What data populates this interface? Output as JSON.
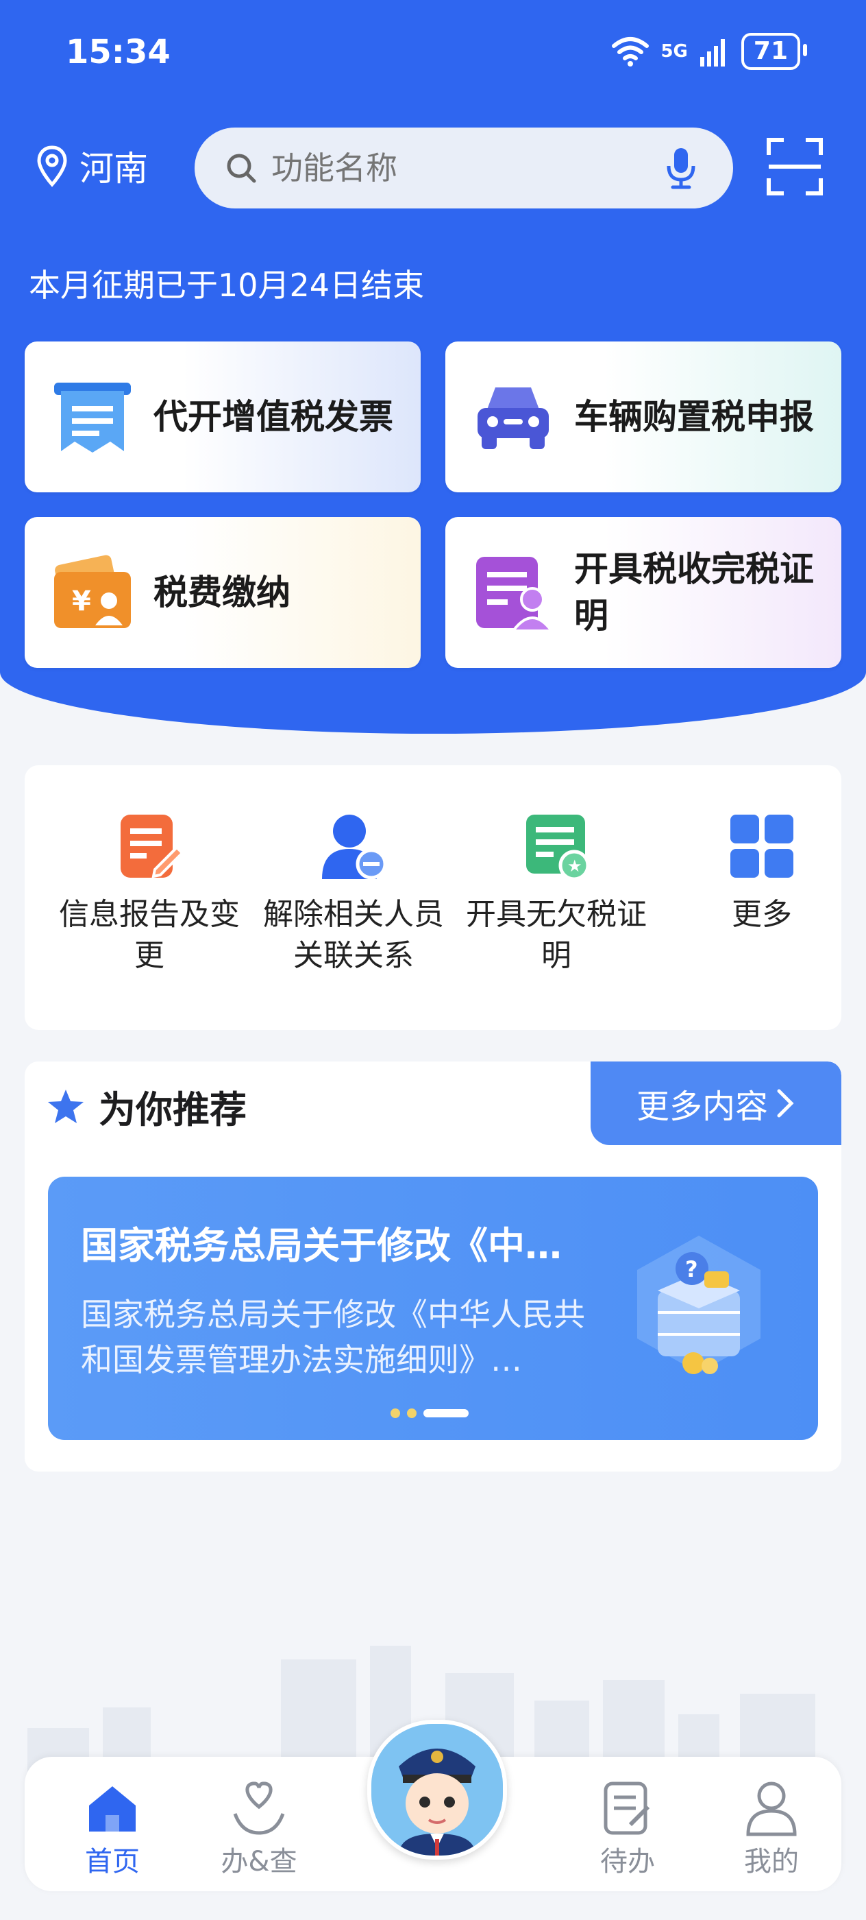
{
  "status_bar": {
    "time": "15:34",
    "network": "5G",
    "battery": "71"
  },
  "header": {
    "location": "河南",
    "search_placeholder": "功能名称",
    "notice": "本月征期已于10月24日结束"
  },
  "main_cards": [
    {
      "label": "代开增值税发票",
      "icon": "invoice-icon",
      "color": "#2f7be6"
    },
    {
      "label": "车辆购置税申报",
      "icon": "car-icon",
      "color": "#4a56d6"
    },
    {
      "label": "税费缴纳",
      "icon": "wallet-icon",
      "color": "#f0902a"
    },
    {
      "label": "开具税收完税证明",
      "icon": "certificate-icon",
      "color": "#a551d8"
    }
  ],
  "quick_actions": [
    {
      "label": "信息报告及变更",
      "icon": "edit-document-icon",
      "color": "#f36c3c"
    },
    {
      "label": "解除相关人员关联关系",
      "icon": "user-remove-icon",
      "color": "#2f66f0"
    },
    {
      "label": "开具无欠税证明",
      "icon": "certificate-star-icon",
      "color": "#3cb87a"
    },
    {
      "label": "更多",
      "icon": "grid-icon",
      "color": "#2f66f0"
    }
  ],
  "recommend": {
    "title": "为你推荐",
    "more": "更多内容",
    "banner_title": "国家税务总局关于修改《中…",
    "banner_desc": "国家税务总局关于修改《中华人民共和国发票管理办法实施细则》…"
  },
  "tabbar": [
    {
      "label": "首页",
      "icon": "home-icon",
      "active": true
    },
    {
      "label": "办&查",
      "icon": "heart-hand-icon",
      "active": false
    },
    {
      "label": "待办",
      "icon": "todo-icon",
      "active": false
    },
    {
      "label": "我的",
      "icon": "profile-icon",
      "active": false
    }
  ]
}
